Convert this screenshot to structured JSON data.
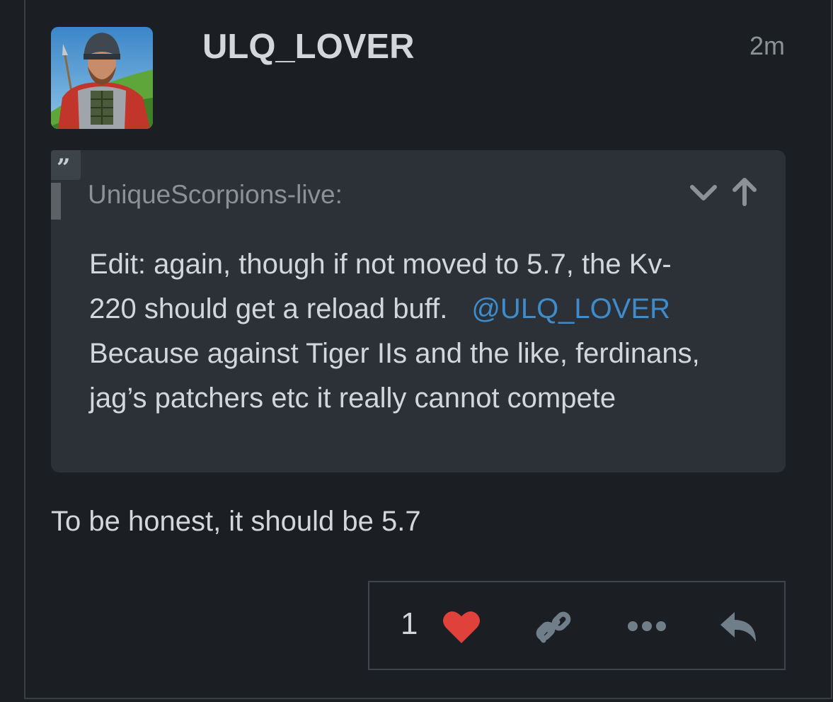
{
  "post": {
    "username": "ULQ_LOVER",
    "time": "2m",
    "quote": {
      "author": "UniqueScorpions-live:",
      "line1": "Edit: again, though if not moved to 5.7, the Kv-",
      "line2_pre": "220 should get a reload buff.",
      "mention": "@ULQ_LOVER",
      "line3": "Because against Tiger IIs and the like, ferdinans,",
      "line4": "jag’s patchers etc it really cannot compete"
    },
    "body": "To be honest, it should be 5.7",
    "actions": {
      "like_count": "1",
      "icons": [
        "heart-icon",
        "link-icon",
        "more-icon",
        "reply-icon"
      ]
    }
  },
  "colors": {
    "background": "#1b1f23",
    "quote_bg": "#2b3137",
    "mention": "#3e8ccc",
    "heart": "#e0413b"
  }
}
